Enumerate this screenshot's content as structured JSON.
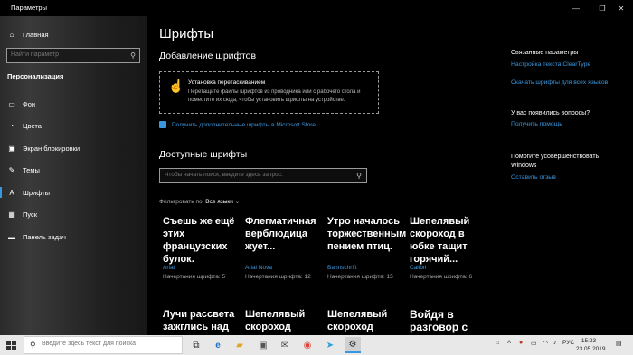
{
  "window": {
    "title": "Параметры",
    "minimize": "—",
    "maximize": "❐",
    "close": "✕"
  },
  "sidebar": {
    "home": "Главная",
    "search_placeholder": "Найти параметр",
    "section": "Персонализация",
    "items": [
      {
        "label": "Фон",
        "icon": "image-icon"
      },
      {
        "label": "Цвета",
        "icon": "palette-icon"
      },
      {
        "label": "Экран блокировки",
        "icon": "lock-screen-icon"
      },
      {
        "label": "Темы",
        "icon": "brush-icon"
      },
      {
        "label": "Шрифты",
        "icon": "font-icon"
      },
      {
        "label": "Пуск",
        "icon": "start-icon"
      },
      {
        "label": "Панель задач",
        "icon": "taskbar-icon"
      }
    ],
    "active_index": 4
  },
  "main": {
    "title": "Шрифты",
    "add_heading": "Добавление шрифтов",
    "drop_title": "Установка перетаскиванием",
    "drop_desc": "Перетащите файлы шрифтов из проводника или с рабочего стола и поместите их сюда, чтобы установить шрифты на устройстве.",
    "store_link": "Получить дополнительные шрифты в Microsoft Store",
    "available_heading": "Доступные шрифты",
    "font_search_placeholder": "Чтобы начать поиск, введите здесь запрос.",
    "filter_label": "Фильтровать по:",
    "filter_value": "Все языки",
    "fonts": [
      {
        "sample": "Съешь же ещё этих французских булок.",
        "name": "Arial",
        "faces": "Начертания шрифта: 5"
      },
      {
        "sample": "Флегматичная верблюдица жует...",
        "name": "Arial Nova",
        "faces": "Начертания шрифта: 12"
      },
      {
        "sample": "Утро началось торжественным пением птиц.",
        "name": "Bahnschrift",
        "faces": "Начертания шрифта: 15"
      },
      {
        "sample": "Шепелявый скороход в юбке тащит горячий...",
        "name": "Calibri",
        "faces": "Начертания шрифта: 6"
      },
      {
        "sample": "Лучи рассвета зажглись над"
      },
      {
        "sample": "Шепелявый скороход"
      },
      {
        "sample": "Шепелявый скороход"
      },
      {
        "sample": "Войдя в разговор с"
      }
    ]
  },
  "related": {
    "heading": "Связанные параметры",
    "links": [
      "Настройка текста ClearType",
      "Скачать шрифты для всех языков"
    ],
    "question_heading": "У вас появились вопросы?",
    "help_link": "Получить помощь",
    "improve_heading": "Помогите усовершенствовать Windows",
    "feedback_link": "Оставить отзыв"
  },
  "taskbar": {
    "search_placeholder": "Введите здесь текст для поиска",
    "apps": [
      "task-view-icon",
      "edge-icon",
      "explorer-icon",
      "mail-icon",
      "chrome-icon",
      "telegram-icon",
      "settings-icon"
    ],
    "lang": "РУС",
    "time": "15:23",
    "date": "23.05.2019"
  }
}
